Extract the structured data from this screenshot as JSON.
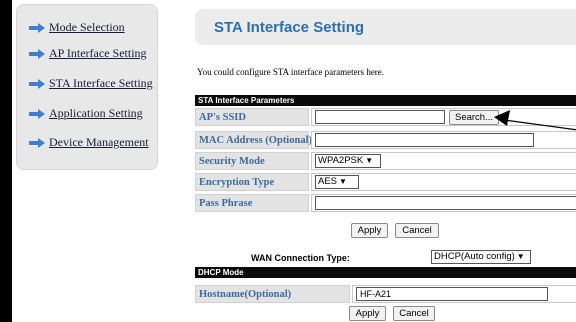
{
  "nav": {
    "items": [
      {
        "label": "Mode Selection"
      },
      {
        "label": "AP Interface Setting"
      },
      {
        "label": "STA Interface Setting"
      },
      {
        "label": "Application Setting"
      },
      {
        "label": "Device Management"
      }
    ]
  },
  "header": {
    "title": "STA Interface Setting"
  },
  "description": "You could configure STA interface parameters here.",
  "sta": {
    "section_title": "STA Interface Parameters",
    "fields": {
      "ssid": {
        "label": "AP's SSID",
        "value": ""
      },
      "search_label": "Search...",
      "mac": {
        "label": "MAC Address (Optional)",
        "value": ""
      },
      "security": {
        "label": "Security Mode",
        "value": "WPA2PSK"
      },
      "encryption": {
        "label": "Encryption Type",
        "value": "AES"
      },
      "passphrase": {
        "label": "Pass Phrase",
        "value": ""
      }
    },
    "apply_label": "Apply",
    "cancel_label": "Cancel"
  },
  "wan": {
    "label": "WAN Connection Type:",
    "value": "DHCP(Auto config)"
  },
  "dhcp": {
    "section_title": "DHCP Mode",
    "hostname": {
      "label": "Hostname(Optional)",
      "value": "HF-A21"
    },
    "apply_label": "Apply",
    "cancel_label": "Cancel"
  },
  "colors": {
    "title": "#2d6fae",
    "label": "#3b6aa0",
    "arrow": "#3f7fd0"
  },
  "icons": {
    "nav_arrow": "right-arrow-icon",
    "select_chevron": "chevron-down-icon"
  }
}
